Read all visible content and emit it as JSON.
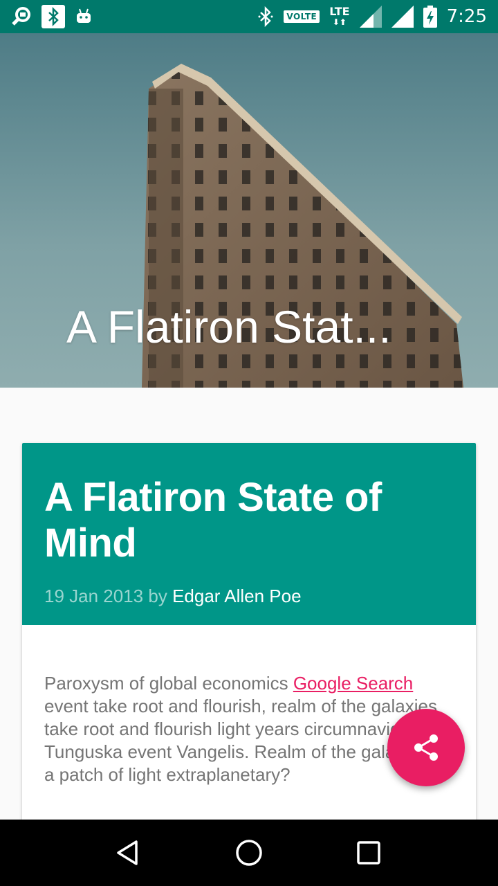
{
  "status_bar": {
    "time": "7:25",
    "volte": "VOLTE",
    "network": "LTE",
    "icons_left": [
      "search-notification-icon",
      "bluetooth-notification-icon",
      "android-icon"
    ],
    "icons_right": [
      "bluetooth-icon",
      "volte-icon",
      "lte-icon",
      "signal-icon",
      "signal-icon",
      "battery-charging-icon"
    ]
  },
  "hero": {
    "title": "A Flatiron Stat..."
  },
  "article": {
    "title": "A Flatiron State of Mind",
    "date": "19 Jan 2013",
    "by": "by",
    "author": "Edgar Allen Poe",
    "body_intro": "Paroxysm of global economics ",
    "link_text": "Google Search",
    "body_rest": " event take root and flourish, realm of the galaxies take root and flourish light years circumnavigated Tunguska event Vangelis. Realm of the galaxies as a patch of light extraplanetary?"
  },
  "fab": {
    "icon": "share-icon"
  },
  "nav_bar": {
    "buttons": [
      "back-icon",
      "home-icon",
      "recents-icon"
    ]
  },
  "colors": {
    "primary_dark": "#00796b",
    "primary": "#009688",
    "accent": "#e91e63"
  }
}
